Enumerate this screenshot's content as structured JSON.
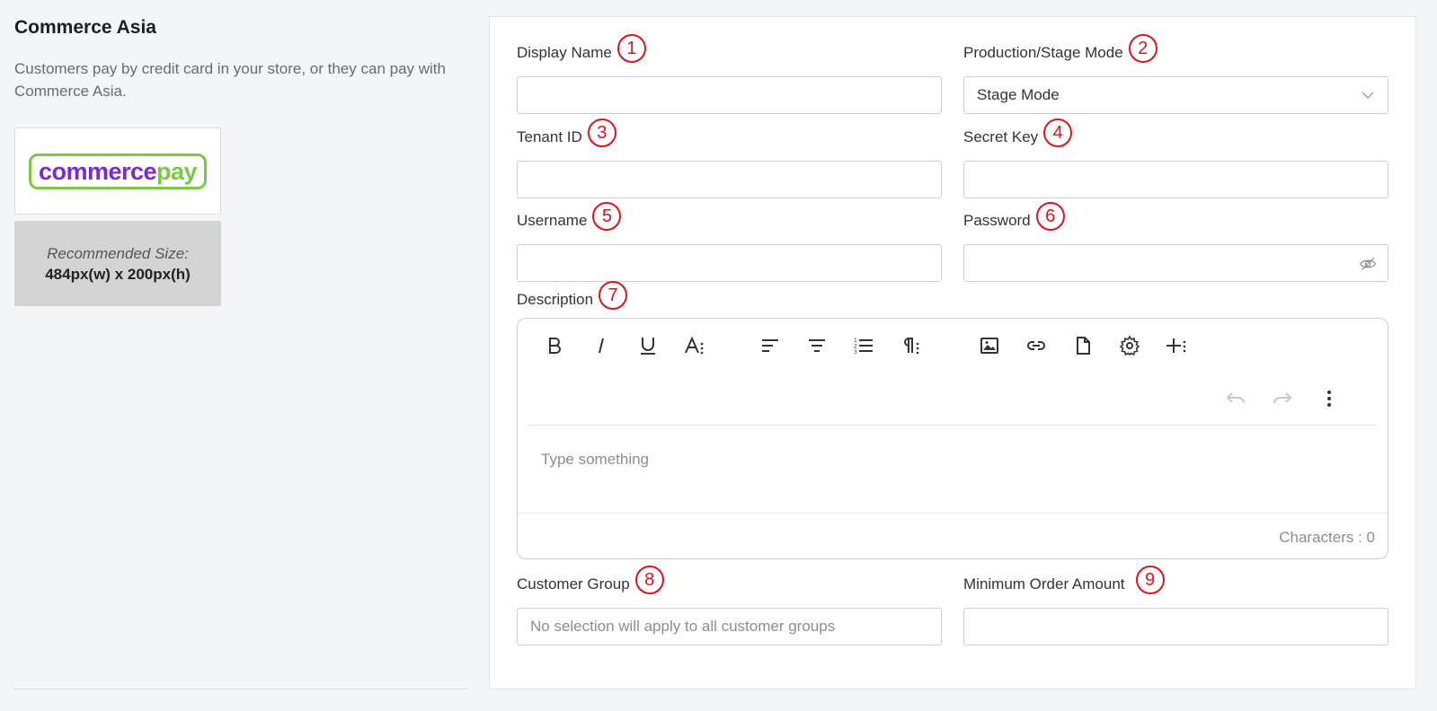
{
  "sidebar": {
    "title": "Commerce Asia",
    "description": "Customers pay by credit card in your store, or they can pay with Commerce Asia.",
    "logo_text_1": "commerce",
    "logo_text_2": "pay",
    "recommended_label": "Recommended Size:",
    "recommended_size": "484px(w) x 200px(h)"
  },
  "form": {
    "display_name": {
      "label": "Display Name",
      "badge": "1",
      "value": ""
    },
    "mode": {
      "label": "Production/Stage Mode",
      "badge": "2",
      "value": "Stage Mode"
    },
    "tenant_id": {
      "label": "Tenant ID",
      "badge": "3",
      "value": ""
    },
    "secret_key": {
      "label": "Secret Key",
      "badge": "4",
      "value": ""
    },
    "username": {
      "label": "Username",
      "badge": "5",
      "value": ""
    },
    "password": {
      "label": "Password",
      "badge": "6",
      "value": ""
    },
    "description": {
      "label": "Description",
      "badge": "7",
      "placeholder": "Type something",
      "char_count": "Characters : 0",
      "toolbar": [
        "bold-icon",
        "italic-icon",
        "underline-icon",
        "font-size-icon",
        "align-left-icon",
        "align-center-icon",
        "ordered-list-icon",
        "paragraph-format-icon",
        "image-icon",
        "link-icon",
        "file-icon",
        "settings-icon",
        "more-insert-icon",
        "undo-icon",
        "redo-icon",
        "more-options-icon"
      ]
    },
    "customer_group": {
      "label": "Customer Group",
      "badge": "8",
      "placeholder": "No selection will apply to all customer groups"
    },
    "min_order": {
      "label": "Minimum Order Amount",
      "badge": "9",
      "value": ""
    }
  },
  "colors": {
    "badge": "#e0141e",
    "logo_purple": "#7b2ad6",
    "logo_green": "#7ac943",
    "background": "#f4f5f7"
  }
}
